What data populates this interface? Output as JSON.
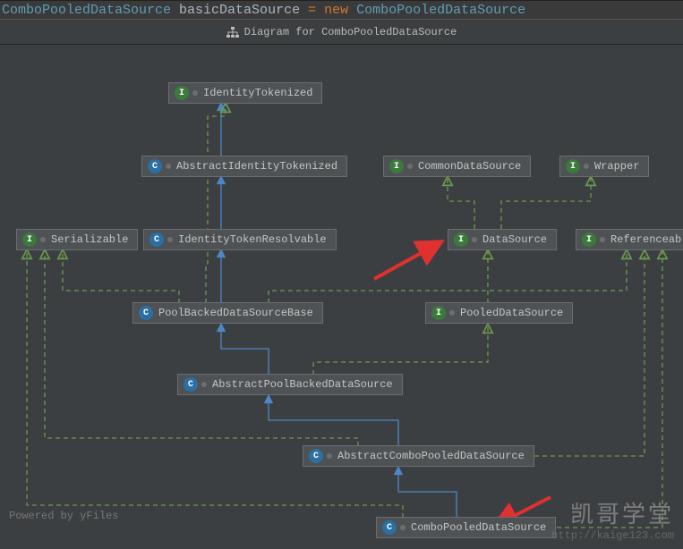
{
  "code": {
    "type1": "ComboPooledDataSource",
    "var": "basicDataSource",
    "op": "=",
    "kw": "new",
    "type2": "ComboPooledDataSource"
  },
  "tab": {
    "label": "Diagram for ComboPooledDataSource"
  },
  "nodes": {
    "identityTokenized": {
      "kind": "I",
      "label": "IdentityTokenized"
    },
    "abstractIdentityTokenized": {
      "kind": "C",
      "label": "AbstractIdentityTokenized"
    },
    "commonDataSource": {
      "kind": "I",
      "label": "CommonDataSource"
    },
    "wrapper": {
      "kind": "I",
      "label": "Wrapper"
    },
    "serializable": {
      "kind": "I",
      "label": "Serializable"
    },
    "identityTokenResolvable": {
      "kind": "C",
      "label": "IdentityTokenResolvable"
    },
    "dataSource": {
      "kind": "I",
      "label": "DataSource"
    },
    "referenceable": {
      "kind": "I",
      "label": "Referenceable"
    },
    "poolBackedDataSourceBase": {
      "kind": "C",
      "label": "PoolBackedDataSourceBase"
    },
    "pooledDataSource": {
      "kind": "I",
      "label": "PooledDataSource"
    },
    "abstractPoolBackedDataSource": {
      "kind": "C",
      "label": "AbstractPoolBackedDataSource"
    },
    "abstractComboPooledDataSource": {
      "kind": "C",
      "label": "AbstractComboPooledDataSource"
    },
    "comboPooledDataSource": {
      "kind": "C",
      "label": "ComboPooledDataSource"
    }
  },
  "footer": {
    "powered": "Powered by yFiles",
    "watermark_cn": "凯哥学堂",
    "watermark_url": "http://kaige123.com"
  }
}
